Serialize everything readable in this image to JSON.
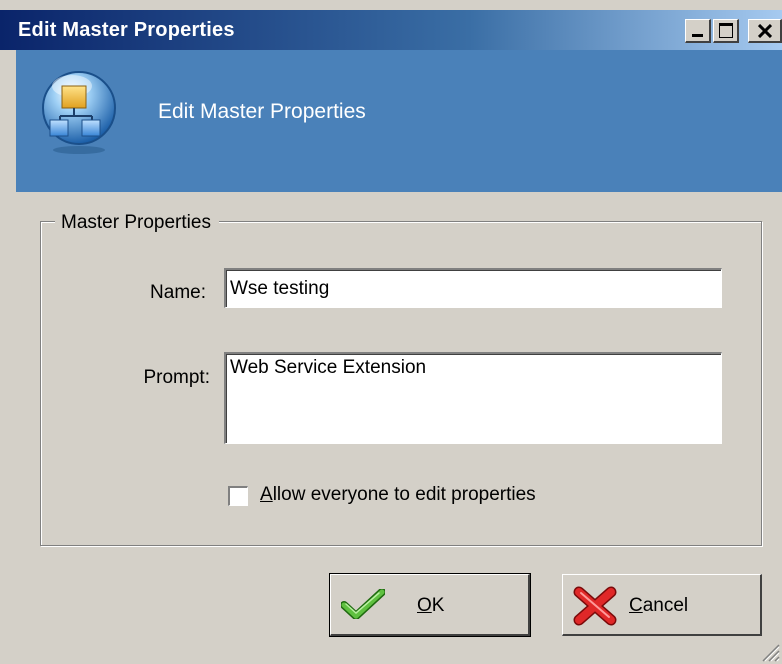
{
  "window": {
    "title": "Edit Master Properties",
    "controls": [
      "minimize-icon",
      "maximize-icon",
      "close-icon"
    ]
  },
  "header": {
    "title": "Edit Master Properties",
    "icon": "hierarchy-icon"
  },
  "group": {
    "legend": "Master Properties"
  },
  "fields": {
    "name_label": "Name:",
    "name_value": "Wse testing",
    "prompt_label": "Prompt:",
    "prompt_value": "Web Service Extension"
  },
  "checkbox": {
    "accel": "A",
    "label_rest": "llow everyone to edit properties",
    "checked": false
  },
  "buttons": {
    "ok_accel": "O",
    "ok_rest": "K",
    "ok_icon": "checkmark-icon",
    "cancel_accel": "C",
    "cancel_rest": "ancel",
    "cancel_icon": "red-x-icon"
  },
  "colors": {
    "banner": "#4a81b9",
    "titlebar_start": "#0a246a",
    "dialog_bg": "#d4d0c8"
  }
}
